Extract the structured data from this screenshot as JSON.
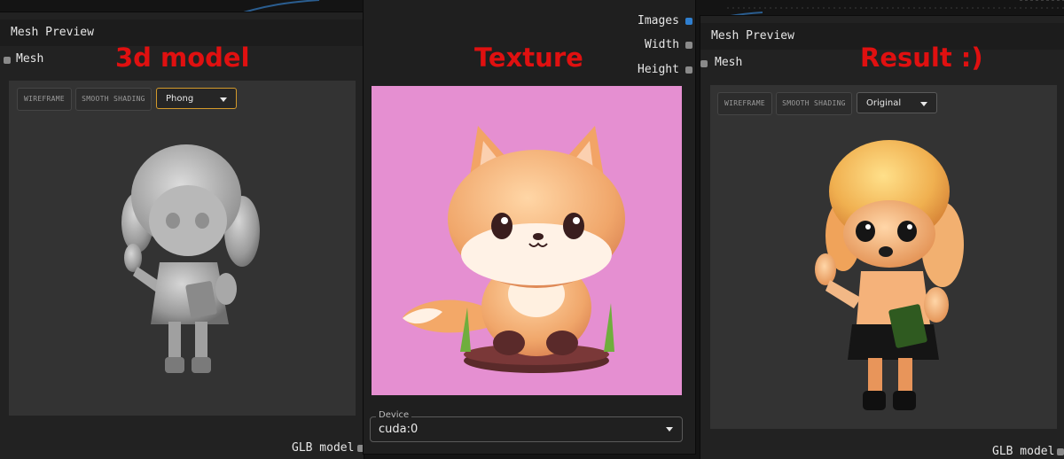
{
  "annotations": {
    "left": "3d model",
    "middle": "Texture",
    "right": "Result :)"
  },
  "left_node": {
    "title": "Mesh Preview",
    "input_label": "Mesh",
    "output_label": "GLB model",
    "toolbar": {
      "wireframe_label": "WIREFRAME",
      "smooth_shading_label": "SMOOTH SHADING",
      "shading_mode_value": "Phong"
    }
  },
  "middle_node": {
    "outputs": [
      "Images",
      "Width",
      "Height"
    ],
    "device_label": "Device",
    "device_value": "cuda:0"
  },
  "right_node": {
    "title": "Mesh Preview",
    "input_label": "Mesh",
    "output_label": "GLB model",
    "toolbar": {
      "wireframe_label": "WIREFRAME",
      "smooth_shading_label": "SMOOTH SHADING",
      "shading_mode_value": "Original"
    }
  },
  "colors": {
    "annotation_red": "#e01010",
    "texture_background": "#e58fd1",
    "active_dropdown_border": "#d39a2b",
    "link_blue": "#2f7fd0"
  }
}
